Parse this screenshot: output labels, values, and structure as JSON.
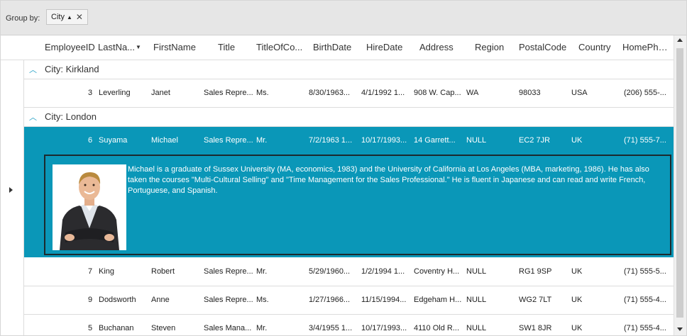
{
  "group_panel": {
    "label": "Group by:",
    "chip_label": "City",
    "chip_sort_icon": "sort-ascending-icon",
    "chip_close_icon": "close-icon"
  },
  "columns": [
    "EmployeeID",
    "LastNa...",
    "FirstName",
    "Title",
    "TitleOfCo...",
    "BirthDate",
    "HireDate",
    "Address",
    "Region",
    "PostalCode",
    "Country",
    "HomePho..."
  ],
  "groups": [
    {
      "label": "City: Kirkland",
      "rows": [
        [
          "3",
          "Leverling",
          "Janet",
          "Sales Repre...",
          "Ms.",
          "8/30/1963...",
          "4/1/1992 1...",
          "908 W. Cap...",
          "WA",
          "98033",
          "USA",
          "(206) 555-..."
        ]
      ]
    },
    {
      "label": "City: London",
      "rows": [
        [
          "6",
          "Suyama",
          "Michael",
          "Sales Repre...",
          "Mr.",
          "7/2/1963 1...",
          "10/17/1993...",
          "14 Garrett...",
          "NULL",
          "EC2 7JR",
          "UK",
          "(71) 555-7..."
        ],
        [
          "7",
          "King",
          "Robert",
          "Sales Repre...",
          "Mr.",
          "5/29/1960...",
          "1/2/1994 1...",
          "Coventry H...",
          "NULL",
          "RG1 9SP",
          "UK",
          "(71) 555-5..."
        ],
        [
          "9",
          "Dodsworth",
          "Anne",
          "Sales Repre...",
          "Ms.",
          "1/27/1966...",
          "11/15/1994...",
          "Edgeham H...",
          "NULL",
          "WG2 7LT",
          "UK",
          "(71) 555-4..."
        ],
        [
          "5",
          "Buchanan",
          "Steven",
          "Sales Mana...",
          "Mr.",
          "3/4/1955 1...",
          "10/17/1993...",
          "4110 Old R...",
          "NULL",
          "SW1 8JR",
          "UK",
          "(71) 555-4..."
        ]
      ]
    }
  ],
  "details": {
    "notes": "Michael is a graduate of Sussex University (MA, economics, 1983) and the University of California at Los Angeles (MBA, marketing, 1986).  He has also taken the courses \"Multi-Cultural Selling\" and \"Time Management for the Sales Professional.\"  He is fluent in Japanese and can read and write French, Portuguese, and Spanish."
  },
  "colors": {
    "selection": "#0a97b8",
    "accent": "#1a9cc2"
  }
}
